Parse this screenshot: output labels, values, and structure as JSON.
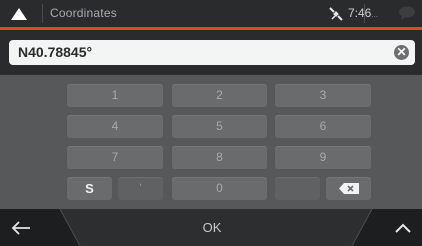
{
  "header": {
    "title": "Coordinates",
    "time": "7:46",
    "time_suffix": "..."
  },
  "input": {
    "value": "N40.78845°"
  },
  "keypad": {
    "row1": [
      "1",
      "2",
      "3"
    ],
    "row2": [
      "4",
      "5",
      "6"
    ],
    "row3": [
      "7",
      "8",
      "9"
    ],
    "row4": {
      "s_label": "S",
      "dot_label": "'",
      "zero_label": "0",
      "blank_label": ""
    }
  },
  "footer": {
    "ok_label": "OK"
  },
  "colors": {
    "accent": "#e8461e",
    "bar": "#2a2b2d",
    "body": "#575859"
  }
}
